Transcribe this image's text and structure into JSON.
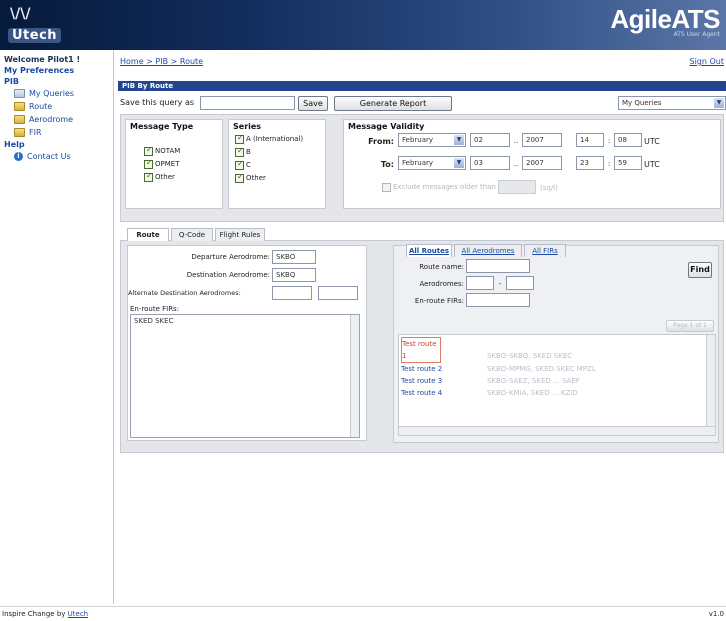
{
  "header": {
    "logo_glyph": "\\/\\/",
    "logo_text": "Utech",
    "app_name": "AgileATS",
    "app_sub": "ATS User Agent"
  },
  "sidebar": {
    "welcome": "Welcome Pilot1 !",
    "my_prefs": "My Preferences",
    "pib": "PIB",
    "items": [
      {
        "label": "My Queries",
        "icon": "queries-icon"
      },
      {
        "label": "Route",
        "icon": "folder-icon"
      },
      {
        "label": "Aerodrome",
        "icon": "folder-icon"
      },
      {
        "label": "FIR",
        "icon": "folder-icon"
      }
    ],
    "help": "Help",
    "contact": "Contact Us"
  },
  "topbar": {
    "breadcrumb": "Home > PIB > Route",
    "signout": "Sign Out"
  },
  "title": "PIB By Route",
  "savebar": {
    "label": "Save this query as",
    "query_name": "",
    "save_btn": "Save",
    "generate_btn": "Generate Report",
    "queries_select": "My Queries"
  },
  "message_type": {
    "title": "Message Type",
    "items": [
      {
        "label": "NOTAM",
        "checked": true
      },
      {
        "label": "OPMET",
        "checked": true
      },
      {
        "label": "Other",
        "checked": true
      }
    ]
  },
  "series": {
    "title": "Series",
    "items": [
      {
        "label": "A (International)",
        "checked": true
      },
      {
        "label": "B",
        "checked": true
      },
      {
        "label": "C",
        "checked": true
      },
      {
        "label": "Other",
        "checked": true
      }
    ]
  },
  "validity": {
    "title": "Message Validity",
    "from_label": "From:",
    "to_label": "To:",
    "from": {
      "month": "February",
      "day": "02",
      "year": "2007",
      "hour": "14",
      "minute": "08"
    },
    "to": {
      "month": "February",
      "day": "03",
      "year": "2007",
      "hour": "23",
      "minute": "59"
    },
    "utc": "UTC",
    "exclude_label": "Exclude messages older than",
    "exclude_unit": "(sq/l)",
    "sep_dot": "..",
    "sep_colon": ":"
  },
  "tabs": [
    "Route",
    "Q-Code",
    "Flight Rules"
  ],
  "route_form": {
    "dep_label": "Departure Aerodrome:",
    "dep_value": "SKBO",
    "dest_label": "Destination Aerodrome:",
    "dest_value": "SKBQ",
    "alt_label": "Alternate Destination Aerodromes:",
    "alt1": "",
    "alt2": "",
    "enroute_label": "En-route FIRs:",
    "enroute_value": "SKED SKEC"
  },
  "right_tabs": [
    "All Routes",
    "All Aerodromes",
    "All FIRs"
  ],
  "right_form": {
    "route_name_label": "Route name:",
    "aerodromes_label": "Aerodromes:",
    "dash": "-",
    "enroute_label": "En-route FIRs:",
    "find_btn": "Find",
    "page_label": "Page 1 of 1"
  },
  "routes": [
    {
      "name": "Test route 1",
      "detail": "SKBO-SKBQ, SKED SKEC",
      "selected": true
    },
    {
      "name": "Test route 2",
      "detail": "SKBO-MPMG, SKED SKEC MPZL"
    },
    {
      "name": "Test route 3",
      "detail": "SKBO-SAEZ, SKED ... SAEF"
    },
    {
      "name": "Test route 4",
      "detail": "SKBO-KMIA, SKED ... KZID"
    }
  ],
  "footer": {
    "prefix": "Inspire Change by",
    "link": "Utech",
    "version": "v1.0"
  }
}
